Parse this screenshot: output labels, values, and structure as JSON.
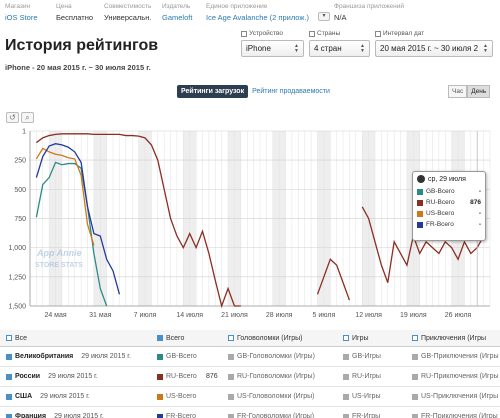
{
  "meta": {
    "store_label": "Магазин",
    "store_value": "iOS Store",
    "price_label": "Цена",
    "price_value": "Бесплатно",
    "compat_label": "Совместимость",
    "compat_value": "Универсальн.",
    "publisher_label": "Издатель",
    "publisher_value": "Gameloft",
    "unified_label": "Единое приложение",
    "unified_value": "Ice Age Avalanche (2 прилож.)",
    "franchise_label": "Франшиза приложений",
    "franchise_value": "N/A"
  },
  "page": {
    "title": "История рейтингов",
    "subtitle": "iPhone - 20 мая 2015 г. ~ 30 июля 2015 г."
  },
  "filters": {
    "device_label": "Устройство",
    "device_value": "iPhone",
    "countries_label": "Страны",
    "countries_value": "4 стран",
    "interval_label": "Интервал дат",
    "interval_value": "20 мая 2015 г. ~ 30 июля 2"
  },
  "tabs": {
    "active": "Рейтинги загрузок",
    "other": "Рейтинг продаваемости"
  },
  "granularity": {
    "hour": "Час",
    "day": "День"
  },
  "controls": {
    "undo": "↺",
    "zoom": "⌕"
  },
  "watermark": {
    "line1": "App Annie",
    "line2": "STORE STATS"
  },
  "colors": {
    "gb": "#2a8a8a",
    "ru": "#8b2e22",
    "us": "#d07818",
    "fr": "#243a9a"
  },
  "tooltip": {
    "title": "ср, 29 июля",
    "rows": [
      {
        "name": "GB-Всего",
        "value": "-"
      },
      {
        "name": "RU-Всего",
        "value": "876"
      },
      {
        "name": "US-Всего",
        "value": "-"
      },
      {
        "name": "FR-Всего",
        "value": "-"
      }
    ]
  },
  "chart_data": {
    "type": "line",
    "y_tick_labels": [
      "1",
      "250",
      "500",
      "750",
      "1,000",
      "1,250",
      "1,500"
    ],
    "x_tick_labels": [
      "24 мая",
      "31 мая",
      "7 июля",
      "14 июля",
      "21 июля",
      "28 июля",
      "5 июля",
      "12 июля",
      "19 июля",
      "26 июля"
    ],
    "ylim": [
      1500,
      1
    ],
    "series": [
      {
        "name": "GB-Всего",
        "x": [
          1,
          2,
          3,
          4,
          5,
          6,
          7,
          8,
          9,
          10,
          11,
          12
        ],
        "values": [
          740,
          460,
          400,
          270,
          290,
          280,
          280,
          320,
          650,
          1050,
          1350,
          1500
        ]
      },
      {
        "name": "RU-Всего",
        "x": [
          1,
          2,
          3,
          4,
          5,
          6,
          7,
          8,
          9,
          10,
          11,
          12,
          13,
          14,
          15,
          16,
          17,
          18,
          19,
          20,
          21,
          22,
          23,
          24,
          25,
          26,
          27,
          28,
          29,
          30,
          31,
          32,
          33,
          34,
          35,
          36,
          37,
          38,
          39,
          40,
          41,
          42,
          43,
          44,
          45,
          46,
          47,
          48,
          49,
          50,
          51,
          52,
          53,
          54,
          55,
          56,
          57,
          58,
          59,
          60,
          61,
          62,
          63,
          64,
          65,
          66,
          67,
          68,
          69,
          70,
          71
        ],
        "values": [
          100,
          60,
          40,
          30,
          25,
          25,
          25,
          25,
          25,
          30,
          30,
          30,
          30,
          30,
          40,
          40,
          45,
          60,
          120,
          250,
          500,
          750,
          900,
          1000,
          880,
          1000,
          860,
          1050,
          1280,
          1500,
          1350,
          1500,
          1500,
          null,
          null,
          null,
          null,
          null,
          null,
          null,
          null,
          null,
          null,
          null,
          1400,
          1250,
          1100,
          1150,
          1300,
          1450,
          null,
          650,
          750,
          950,
          1150,
          1300,
          950,
          1050,
          1150,
          900,
          1050,
          950,
          1000,
          1050,
          950,
          1000,
          1100,
          950,
          1050,
          1000,
          900
        ],
        "x_late": [
          45,
          46,
          47,
          48,
          49,
          50,
          51,
          52,
          53,
          54,
          55,
          56,
          57,
          58,
          59,
          60,
          61,
          62,
          63,
          64,
          65,
          66,
          67,
          68,
          69,
          70,
          71
        ]
      },
      {
        "name": "US-Всего",
        "x": [
          1,
          2,
          3,
          4,
          5,
          6,
          7,
          8,
          9,
          10
        ],
        "values": [
          240,
          150,
          180,
          200,
          210,
          230,
          240,
          380,
          800,
          980
        ]
      },
      {
        "name": "FR-Всего",
        "x": [
          1,
          2,
          3,
          4,
          5,
          6,
          7,
          8,
          9,
          10,
          11,
          12,
          13,
          14
        ],
        "values": [
          400,
          220,
          130,
          110,
          120,
          140,
          180,
          270,
          650,
          880,
          900,
          1100,
          1200,
          1400
        ]
      }
    ]
  },
  "table": {
    "headers": [
      "Все",
      "Всего",
      "Головоломки (Игры)",
      "Игры",
      "Приключения (Игры"
    ],
    "rows": [
      {
        "country": "Великобритания",
        "date": "29 июля 2015 г.",
        "total": "GB-Всего",
        "total_val": "",
        "puzzle": "GB-Головоломки (Игры)",
        "games": "GB-Игры",
        "adventure": "GB-Приключения (Игры"
      },
      {
        "country": "России",
        "date": "29 июля 2015 г.",
        "total": "RU-Всего",
        "total_val": "876",
        "puzzle": "RU-Головоломки (Игры)",
        "games": "RU-Игры",
        "adventure": "RU-Приключения (Игры"
      },
      {
        "country": "США",
        "date": "29 июля 2015 г.",
        "total": "US-Всего",
        "total_val": "",
        "puzzle": "US-Головоломки (Игры)",
        "games": "US-Игры",
        "adventure": "US-Приключения (Игры"
      },
      {
        "country": "Франция",
        "date": "29 июля 2015 г.",
        "total": "FR-Всего",
        "total_val": "",
        "puzzle": "FR-Головоломки (Игры)",
        "games": "FR-Игры",
        "adventure": "FR-Приключения (Игры"
      }
    ]
  }
}
